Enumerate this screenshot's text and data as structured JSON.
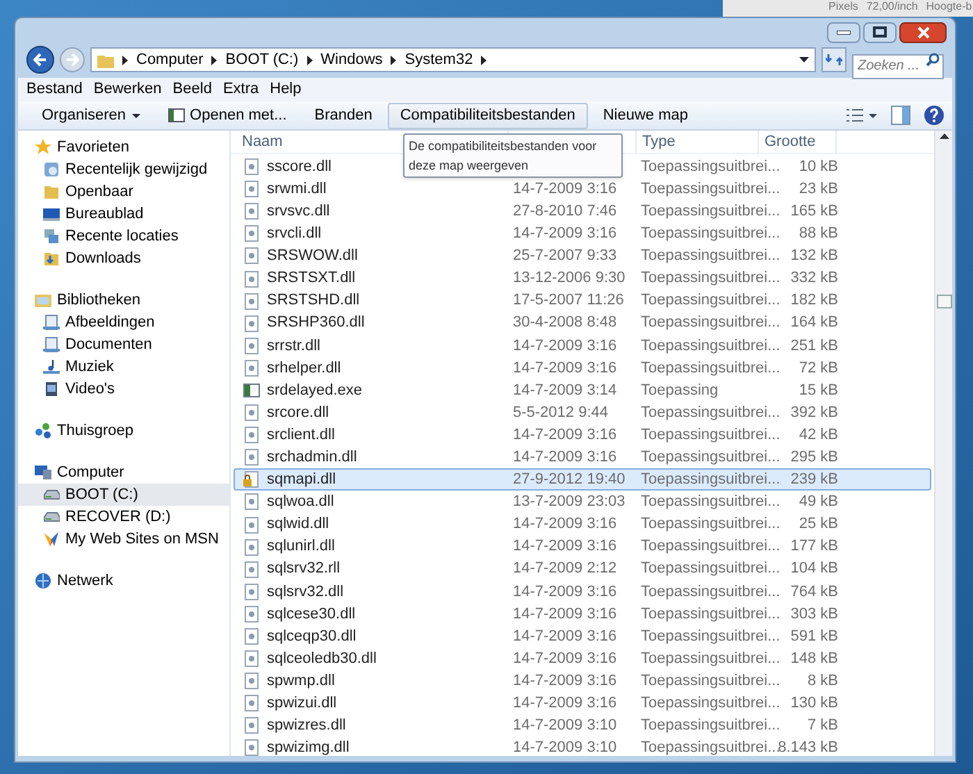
{
  "background_app": {
    "texts": [
      "Pixels",
      "72,00/inch",
      "Hoogte-b"
    ]
  },
  "address_bar": {
    "crumbs": [
      "Computer",
      "BOOT (C:)",
      "Windows",
      "System32"
    ]
  },
  "search": {
    "placeholder": "Zoeken ..."
  },
  "menu": [
    "Bestand",
    "Bewerken",
    "Beeld",
    "Extra",
    "Help"
  ],
  "toolbar": [
    {
      "label": "Organiseren",
      "kind": "dropdown",
      "selected": false
    },
    {
      "label": "Openen met...",
      "kind": "open",
      "selected": false
    },
    {
      "label": "Branden",
      "kind": "plain",
      "selected": false
    },
    {
      "label": "Compatibiliteitsbestanden",
      "kind": "plain",
      "selected": true
    },
    {
      "label": "Nieuwe map",
      "kind": "plain",
      "selected": false
    }
  ],
  "tooltip": "De compatibiliteitsbestanden voor deze map weergeven",
  "sidebar": [
    {
      "label": "Favorieten",
      "children": [
        {
          "label": "Recentelijk gewijzigd",
          "selected": false
        },
        {
          "label": "Openbaar",
          "selected": false
        },
        {
          "label": "Bureaublad",
          "selected": false
        },
        {
          "label": "Recente locaties",
          "selected": false
        },
        {
          "label": "Downloads",
          "selected": false
        }
      ]
    },
    {
      "label": "Bibliotheken",
      "children": [
        {
          "label": "Afbeeldingen",
          "selected": false
        },
        {
          "label": "Documenten",
          "selected": false
        },
        {
          "label": "Muziek",
          "selected": false
        },
        {
          "label": "Video's",
          "selected": false
        }
      ]
    },
    {
      "label": "Thuisgroep"
    },
    {
      "label": "Computer",
      "children": [
        {
          "label": "BOOT (C:)",
          "selected": true
        },
        {
          "label": "RECOVER (D:)",
          "selected": false
        },
        {
          "label": "My Web Sites on MSN",
          "selected": false
        }
      ]
    },
    {
      "label": "Netwerk"
    }
  ],
  "table": {
    "columns": [
      "Naam",
      "Type",
      "Grootte"
    ],
    "rows": [
      {
        "name": "sscore.dll",
        "type": "Toepassingsuitbrei...",
        "size": "10 kB",
        "kind": "dll",
        "selected": false
      },
      {
        "name": "srwmi.dll",
        "modified": "14-7-2009 3:16",
        "type": "Toepassingsuitbrei...",
        "size": "23 kB",
        "kind": "dll",
        "selected": false
      },
      {
        "name": "srvsvc.dll",
        "modified": "27-8-2010 7:46",
        "type": "Toepassingsuitbrei...",
        "size": "165 kB",
        "kind": "dll",
        "selected": false
      },
      {
        "name": "srvcli.dll",
        "modified": "14-7-2009 3:16",
        "type": "Toepassingsuitbrei...",
        "size": "88 kB",
        "kind": "dll",
        "selected": false
      },
      {
        "name": "SRSWOW.dll",
        "modified": "25-7-2007 9:33",
        "type": "Toepassingsuitbrei...",
        "size": "132 kB",
        "kind": "dll",
        "selected": false
      },
      {
        "name": "SRSTSXT.dll",
        "modified": "13-12-2006 9:30",
        "type": "Toepassingsuitbrei...",
        "size": "332 kB",
        "kind": "dll",
        "selected": false
      },
      {
        "name": "SRSTSHD.dll",
        "modified": "17-5-2007 11:26",
        "type": "Toepassingsuitbrei...",
        "size": "182 kB",
        "kind": "dll",
        "selected": false
      },
      {
        "name": "SRSHP360.dll",
        "modified": "30-4-2008 8:48",
        "type": "Toepassingsuitbrei...",
        "size": "164 kB",
        "kind": "dll",
        "selected": false
      },
      {
        "name": "srrstr.dll",
        "modified": "14-7-2009 3:16",
        "type": "Toepassingsuitbrei...",
        "size": "251 kB",
        "kind": "dll",
        "selected": false
      },
      {
        "name": "srhelper.dll",
        "modified": "14-7-2009 3:16",
        "type": "Toepassingsuitbrei...",
        "size": "72 kB",
        "kind": "dll",
        "selected": false
      },
      {
        "name": "srdelayed.exe",
        "modified": "14-7-2009 3:14",
        "type": "Toepassing",
        "size": "15 kB",
        "kind": "exe",
        "selected": false
      },
      {
        "name": "srcore.dll",
        "modified": "5-5-2012 9:44",
        "type": "Toepassingsuitbrei...",
        "size": "392 kB",
        "kind": "dll",
        "selected": false
      },
      {
        "name": "srclient.dll",
        "modified": "14-7-2009 3:16",
        "type": "Toepassingsuitbrei...",
        "size": "42 kB",
        "kind": "dll",
        "selected": false
      },
      {
        "name": "srchadmin.dll",
        "modified": "14-7-2009 3:16",
        "type": "Toepassingsuitbrei...",
        "size": "295 kB",
        "kind": "dll",
        "selected": false
      },
      {
        "name": "sqmapi.dll",
        "modified": "27-9-2012 19:40",
        "type": "Toepassingsuitbrei...",
        "size": "239 kB",
        "kind": "locked",
        "selected": true
      },
      {
        "name": "sqlwoa.dll",
        "modified": "13-7-2009 23:03",
        "type": "Toepassingsuitbrei...",
        "size": "49 kB",
        "kind": "dll",
        "selected": false
      },
      {
        "name": "sqlwid.dll",
        "modified": "14-7-2009 3:16",
        "type": "Toepassingsuitbrei...",
        "size": "25 kB",
        "kind": "dll",
        "selected": false
      },
      {
        "name": "sqlunirl.dll",
        "modified": "14-7-2009 3:16",
        "type": "Toepassingsuitbrei...",
        "size": "177 kB",
        "kind": "dll",
        "selected": false
      },
      {
        "name": "sqlsrv32.rll",
        "modified": "14-7-2009 2:12",
        "type": "Toepassingsuitbrei...",
        "size": "104 kB",
        "kind": "dll",
        "selected": false
      },
      {
        "name": "sqlsrv32.dll",
        "modified": "14-7-2009 3:16",
        "type": "Toepassingsuitbrei...",
        "size": "764 kB",
        "kind": "dll",
        "selected": false
      },
      {
        "name": "sqlcese30.dll",
        "modified": "14-7-2009 3:16",
        "type": "Toepassingsuitbrei...",
        "size": "303 kB",
        "kind": "dll",
        "selected": false
      },
      {
        "name": "sqlceqp30.dll",
        "modified": "14-7-2009 3:16",
        "type": "Toepassingsuitbrei...",
        "size": "591 kB",
        "kind": "dll",
        "selected": false
      },
      {
        "name": "sqlceoledb30.dll",
        "modified": "14-7-2009 3:16",
        "type": "Toepassingsuitbrei...",
        "size": "148 kB",
        "kind": "dll",
        "selected": false
      },
      {
        "name": "spwmp.dll",
        "modified": "14-7-2009 3:16",
        "type": "Toepassingsuitbrei...",
        "size": "8 kB",
        "kind": "dll",
        "selected": false
      },
      {
        "name": "spwizui.dll",
        "modified": "14-7-2009 3:16",
        "type": "Toepassingsuitbrei...",
        "size": "130 kB",
        "kind": "dll",
        "selected": false
      },
      {
        "name": "spwizres.dll",
        "modified": "14-7-2009 3:10",
        "type": "Toepassingsuitbrei...",
        "size": "7 kB",
        "kind": "dll",
        "selected": false
      },
      {
        "name": "spwizimg.dll",
        "modified": "14-7-2009 3:10",
        "type": "Toepassingsuitbrei...",
        "size": "8.143 kB",
        "kind": "dll",
        "selected": false
      }
    ]
  }
}
